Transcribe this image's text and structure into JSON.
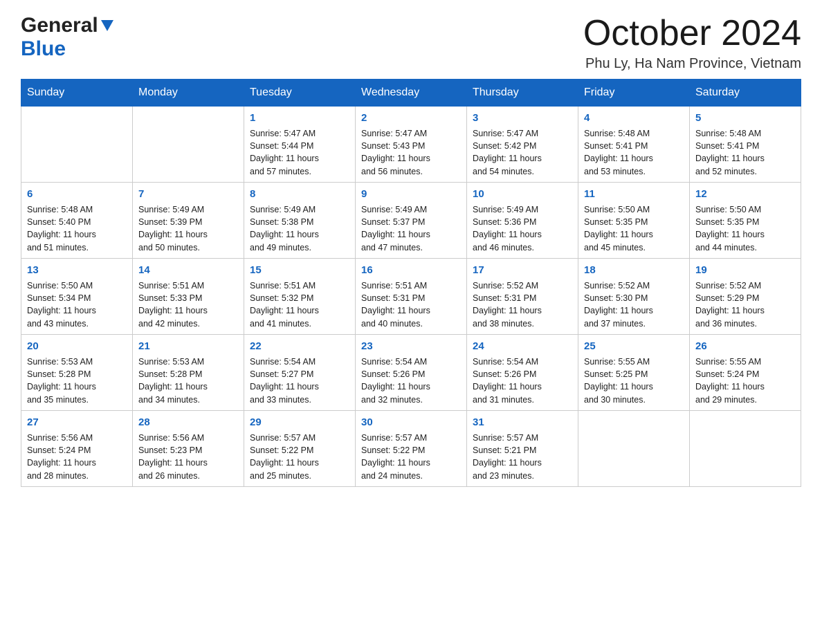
{
  "header": {
    "logo_general": "General",
    "logo_blue": "Blue",
    "month_title": "October 2024",
    "location": "Phu Ly, Ha Nam Province, Vietnam"
  },
  "days_of_week": [
    "Sunday",
    "Monday",
    "Tuesday",
    "Wednesday",
    "Thursday",
    "Friday",
    "Saturday"
  ],
  "weeks": [
    [
      {
        "day": "",
        "info": ""
      },
      {
        "day": "",
        "info": ""
      },
      {
        "day": "1",
        "info": "Sunrise: 5:47 AM\nSunset: 5:44 PM\nDaylight: 11 hours\nand 57 minutes."
      },
      {
        "day": "2",
        "info": "Sunrise: 5:47 AM\nSunset: 5:43 PM\nDaylight: 11 hours\nand 56 minutes."
      },
      {
        "day": "3",
        "info": "Sunrise: 5:47 AM\nSunset: 5:42 PM\nDaylight: 11 hours\nand 54 minutes."
      },
      {
        "day": "4",
        "info": "Sunrise: 5:48 AM\nSunset: 5:41 PM\nDaylight: 11 hours\nand 53 minutes."
      },
      {
        "day": "5",
        "info": "Sunrise: 5:48 AM\nSunset: 5:41 PM\nDaylight: 11 hours\nand 52 minutes."
      }
    ],
    [
      {
        "day": "6",
        "info": "Sunrise: 5:48 AM\nSunset: 5:40 PM\nDaylight: 11 hours\nand 51 minutes."
      },
      {
        "day": "7",
        "info": "Sunrise: 5:49 AM\nSunset: 5:39 PM\nDaylight: 11 hours\nand 50 minutes."
      },
      {
        "day": "8",
        "info": "Sunrise: 5:49 AM\nSunset: 5:38 PM\nDaylight: 11 hours\nand 49 minutes."
      },
      {
        "day": "9",
        "info": "Sunrise: 5:49 AM\nSunset: 5:37 PM\nDaylight: 11 hours\nand 47 minutes."
      },
      {
        "day": "10",
        "info": "Sunrise: 5:49 AM\nSunset: 5:36 PM\nDaylight: 11 hours\nand 46 minutes."
      },
      {
        "day": "11",
        "info": "Sunrise: 5:50 AM\nSunset: 5:35 PM\nDaylight: 11 hours\nand 45 minutes."
      },
      {
        "day": "12",
        "info": "Sunrise: 5:50 AM\nSunset: 5:35 PM\nDaylight: 11 hours\nand 44 minutes."
      }
    ],
    [
      {
        "day": "13",
        "info": "Sunrise: 5:50 AM\nSunset: 5:34 PM\nDaylight: 11 hours\nand 43 minutes."
      },
      {
        "day": "14",
        "info": "Sunrise: 5:51 AM\nSunset: 5:33 PM\nDaylight: 11 hours\nand 42 minutes."
      },
      {
        "day": "15",
        "info": "Sunrise: 5:51 AM\nSunset: 5:32 PM\nDaylight: 11 hours\nand 41 minutes."
      },
      {
        "day": "16",
        "info": "Sunrise: 5:51 AM\nSunset: 5:31 PM\nDaylight: 11 hours\nand 40 minutes."
      },
      {
        "day": "17",
        "info": "Sunrise: 5:52 AM\nSunset: 5:31 PM\nDaylight: 11 hours\nand 38 minutes."
      },
      {
        "day": "18",
        "info": "Sunrise: 5:52 AM\nSunset: 5:30 PM\nDaylight: 11 hours\nand 37 minutes."
      },
      {
        "day": "19",
        "info": "Sunrise: 5:52 AM\nSunset: 5:29 PM\nDaylight: 11 hours\nand 36 minutes."
      }
    ],
    [
      {
        "day": "20",
        "info": "Sunrise: 5:53 AM\nSunset: 5:28 PM\nDaylight: 11 hours\nand 35 minutes."
      },
      {
        "day": "21",
        "info": "Sunrise: 5:53 AM\nSunset: 5:28 PM\nDaylight: 11 hours\nand 34 minutes."
      },
      {
        "day": "22",
        "info": "Sunrise: 5:54 AM\nSunset: 5:27 PM\nDaylight: 11 hours\nand 33 minutes."
      },
      {
        "day": "23",
        "info": "Sunrise: 5:54 AM\nSunset: 5:26 PM\nDaylight: 11 hours\nand 32 minutes."
      },
      {
        "day": "24",
        "info": "Sunrise: 5:54 AM\nSunset: 5:26 PM\nDaylight: 11 hours\nand 31 minutes."
      },
      {
        "day": "25",
        "info": "Sunrise: 5:55 AM\nSunset: 5:25 PM\nDaylight: 11 hours\nand 30 minutes."
      },
      {
        "day": "26",
        "info": "Sunrise: 5:55 AM\nSunset: 5:24 PM\nDaylight: 11 hours\nand 29 minutes."
      }
    ],
    [
      {
        "day": "27",
        "info": "Sunrise: 5:56 AM\nSunset: 5:24 PM\nDaylight: 11 hours\nand 28 minutes."
      },
      {
        "day": "28",
        "info": "Sunrise: 5:56 AM\nSunset: 5:23 PM\nDaylight: 11 hours\nand 26 minutes."
      },
      {
        "day": "29",
        "info": "Sunrise: 5:57 AM\nSunset: 5:22 PM\nDaylight: 11 hours\nand 25 minutes."
      },
      {
        "day": "30",
        "info": "Sunrise: 5:57 AM\nSunset: 5:22 PM\nDaylight: 11 hours\nand 24 minutes."
      },
      {
        "day": "31",
        "info": "Sunrise: 5:57 AM\nSunset: 5:21 PM\nDaylight: 11 hours\nand 23 minutes."
      },
      {
        "day": "",
        "info": ""
      },
      {
        "day": "",
        "info": ""
      }
    ]
  ]
}
